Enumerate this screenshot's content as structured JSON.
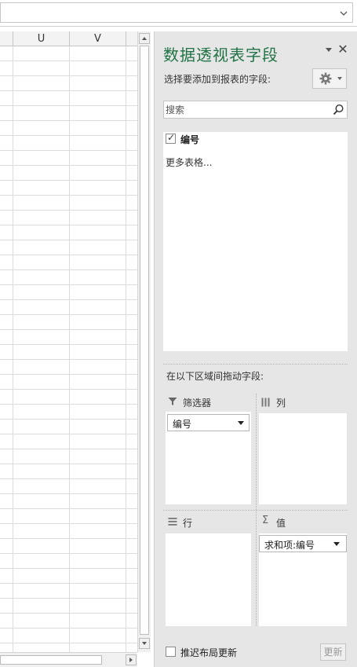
{
  "grid": {
    "columns": [
      {
        "label": ""
      },
      {
        "label": "U"
      },
      {
        "label": "V"
      }
    ]
  },
  "pane": {
    "title": "数据透视表字段",
    "fields_label": "选择要添加到报表的字段:",
    "search_placeholder": "搜索",
    "fields": [
      {
        "label": "编号",
        "checked": true
      }
    ],
    "more_tables": "更多表格...",
    "drag_label": "在以下区域间拖动字段:",
    "areas": {
      "filters": {
        "label": "筛选器",
        "chip": "编号"
      },
      "columns": {
        "label": "列"
      },
      "rows": {
        "label": "行"
      },
      "values": {
        "label": "值",
        "chip": "求和项:编号"
      }
    },
    "defer_label": "推迟布局更新",
    "update_label": "更新"
  },
  "colors": {
    "title": "#217346",
    "pane_bg": "#e6e6e6"
  }
}
